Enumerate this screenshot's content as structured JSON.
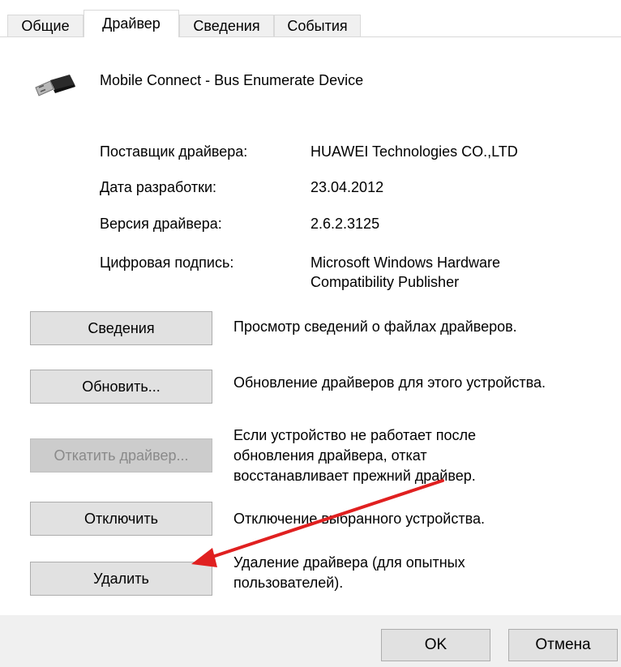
{
  "tabs": [
    {
      "label": "Общие"
    },
    {
      "label": "Драйвер",
      "active": true
    },
    {
      "label": "Сведения"
    },
    {
      "label": "События"
    }
  ],
  "device": {
    "name": "Mobile Connect - Bus Enumerate Device",
    "icon": "usb-device-icon"
  },
  "info": {
    "provider_label": "Поставщик драйвера:",
    "provider_value": "HUAWEI Technologies CO.,LTD",
    "date_label": "Дата разработки:",
    "date_value": "23.04.2012",
    "version_label": "Версия драйвера:",
    "version_value": "2.6.2.3125",
    "signature_label": "Цифровая подпись:",
    "signature_value_line1": "Microsoft Windows Hardware",
    "signature_value_line2": "Compatibility Publisher"
  },
  "actions": {
    "details_label": "Сведения",
    "details_desc": "Просмотр сведений о файлах драйверов.",
    "update_label": "Обновить...",
    "update_desc": "Обновление драйверов для этого устройства.",
    "rollback_label": "Откатить драйвер...",
    "rollback_desc_line1": "Если устройство не работает после",
    "rollback_desc_line2": "обновления драйвера, откат",
    "rollback_desc_line3": "восстанавливает прежний драйвер.",
    "disable_label": "Отключить",
    "disable_desc": "Отключение выбранного устройства.",
    "uninstall_label": "Удалить",
    "uninstall_desc_line1": "Удаление драйвера (для опытных",
    "uninstall_desc_line2": "пользователей)."
  },
  "footer": {
    "ok_label": "OK",
    "cancel_label": "Отмена"
  },
  "annotation": {
    "arrow_color": "#e02020"
  }
}
